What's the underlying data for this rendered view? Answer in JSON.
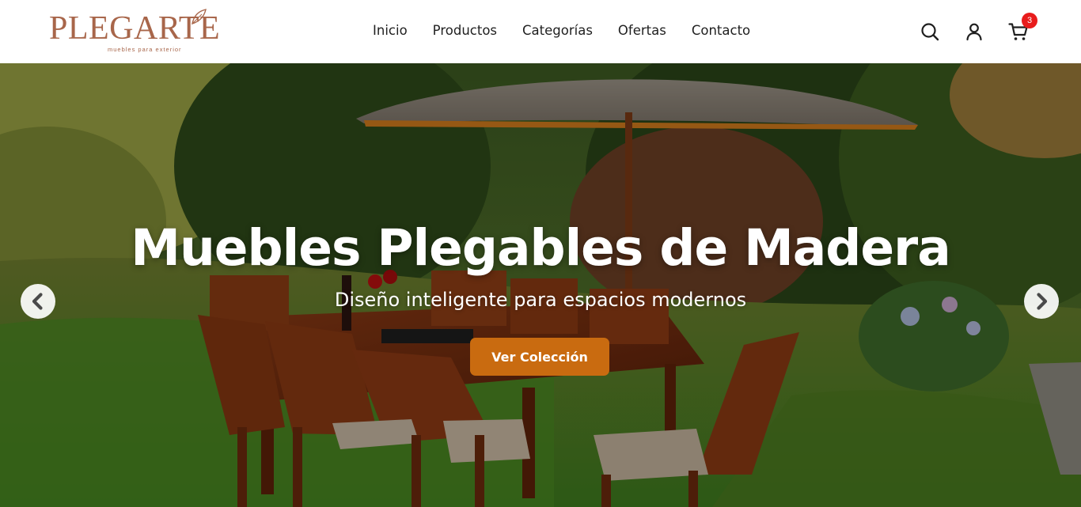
{
  "brand": {
    "logo_text": "PLEGARTE",
    "tagline": "muebles para exterior",
    "logo_color": "#a8664a"
  },
  "nav": {
    "items": [
      {
        "label": "Inicio"
      },
      {
        "label": "Productos"
      },
      {
        "label": "Categorías"
      },
      {
        "label": "Ofertas"
      },
      {
        "label": "Contacto"
      }
    ]
  },
  "header_actions": {
    "search_icon": "search-icon",
    "account_icon": "user-icon",
    "cart_icon": "cart-icon",
    "cart_count": "3",
    "badge_color": "#e81c1c"
  },
  "hero": {
    "title": "Muebles Plegables de Madera",
    "subtitle": "Diseño inteligente para espacios modernos",
    "cta_label": "Ver Colección",
    "cta_color": "#c96b10",
    "prev_icon": "chevron-left-icon",
    "next_icon": "chevron-right-icon"
  }
}
